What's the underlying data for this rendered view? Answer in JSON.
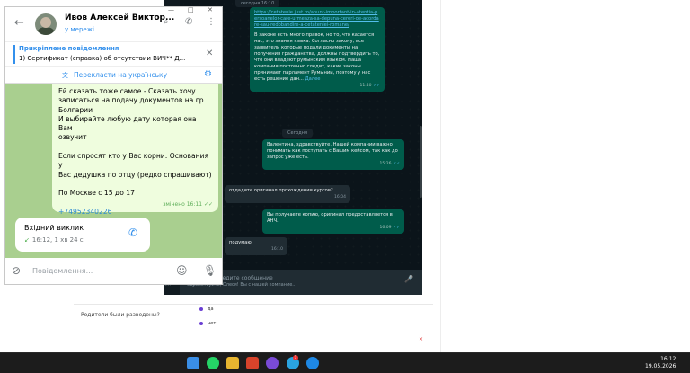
{
  "background_form": {
    "question": "Родители были разведены?",
    "options": [
      "да",
      "нет"
    ],
    "x_mark": "×"
  },
  "whatsapp": {
    "date_top": "сегодня 16:10",
    "today_label": "Сегодня",
    "messages": [
      {
        "link": "https://cetatenie.just.ro/anunt-important-in-atentia-persoanelor-care-urmeaza-sa-depuna-cereri-de-acordare-sau-redobandire-a-cetateniei-romane/",
        "text": "В законе есть много правок, но то, что касается нас, это знания языка. Согласно закону, все заявители которые подали документы на получения гражданства, должны подтвердить то, что они владеют румынским языком. Наша компания постоянно следит, какие законы принимает парламент Румынии, поэтому у нас есть решение дан...",
        "more": "Далее",
        "time": "11:40"
      },
      {
        "text": "Валентина, здравствуйте. Нашей компании важно понимать как поступать с Вашим кейсом, так как до запрос уже есть.",
        "time": "15:26"
      },
      {
        "text": "отдадите оригинал прохождения курсов?",
        "time": "16:04"
      },
      {
        "text": "Вы получаете копию, оригинал предоставляется в АНЧ.",
        "time": "16:09"
      },
      {
        "text": "подумаю",
        "time": "16:10"
      }
    ],
    "composer_placeholder": "Введите сообщение",
    "sidebar_preview_prefix": "4...",
    "sidebar_preview": "Здравствуйте, Олеся! Вы с нашей компание..."
  },
  "telegram": {
    "contact_name": "Ивов Алексей Виктор...",
    "contact_status": "у мережі",
    "pinned_title": "Прикріплене повідомлення",
    "pinned_text": "1) Сертификат (справка) об отсутствии ВИЧ** Д...",
    "translate_label": "Перекласти на українську",
    "message_lines": [
      "Ей сказать тоже самое - Сказать хочу",
      "записаться на подачу документов на гр.",
      "Болгарии",
      "И выбирайте любую дату которая она Вам",
      "озвучит",
      "",
      "Если спросят кто у Вас корни: Основания у",
      "Вас дедушка по отцу (редко спрашивают)",
      "",
      "По Москве с 15 до 17",
      "",
      "+74952340226"
    ],
    "message_meta": "змінено 16:11",
    "call_title": "Вхідний виклик",
    "call_sub": "16:12, 1 хв 24 с",
    "input_placeholder": "Повідомлення..."
  },
  "taskbar": {
    "time": "16:12",
    "date": "19.05.2026",
    "badge": "1"
  },
  "colors": {
    "telegram_accent": "#3390ec",
    "telegram_bg": "#a9cf8f",
    "whatsapp_outgoing": "#005c4b",
    "whatsapp_incoming": "#202c33",
    "taskbar": "#1c1c1c"
  }
}
